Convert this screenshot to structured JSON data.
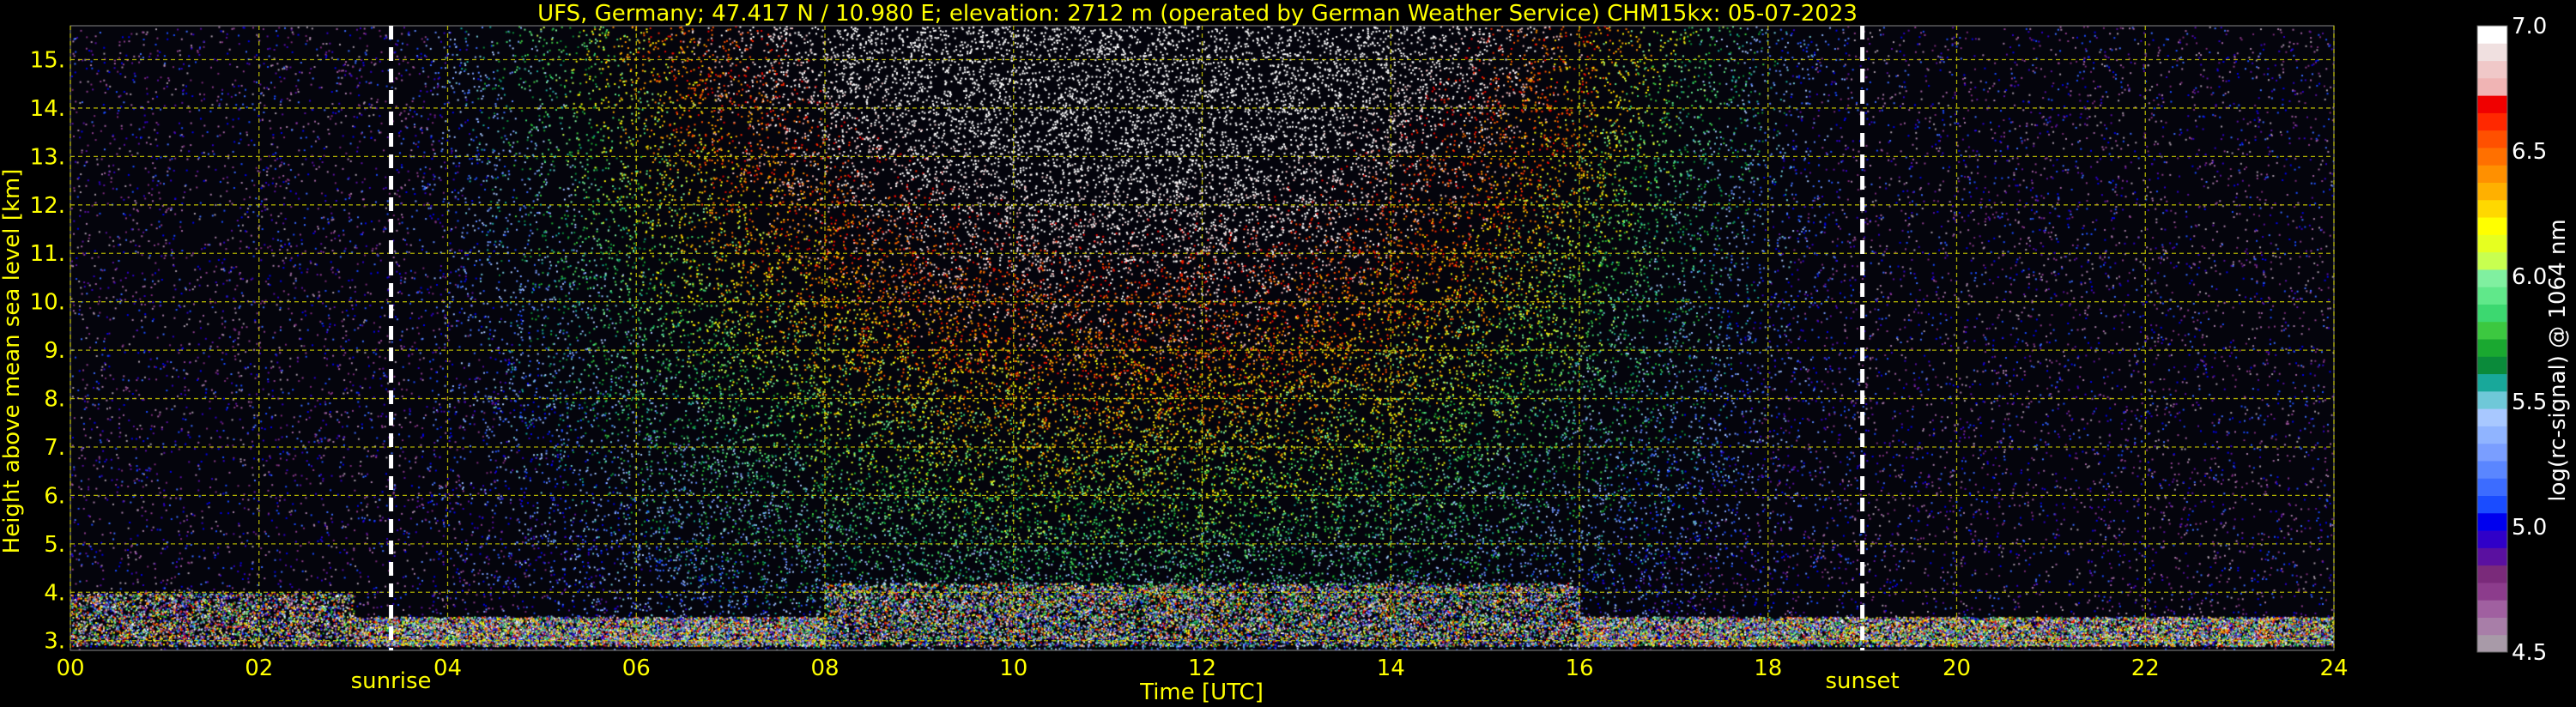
{
  "chart_data": {
    "type": "heatmap",
    "title": "UFS, Germany; 47.417 N / 10.980 E; elevation: 2712 m  (operated by German Weather Service)    CHM15kx: 05-07-2023",
    "xlabel": "Time [UTC]",
    "ylabel": "Height above mean sea level [km]",
    "xlim": [
      0,
      24
    ],
    "ylim": [
      2.8,
      15.7
    ],
    "x_ticks": [
      {
        "v": 0,
        "label": "00"
      },
      {
        "v": 2,
        "label": "02"
      },
      {
        "v": 4,
        "label": "04"
      },
      {
        "v": 6,
        "label": "06"
      },
      {
        "v": 8,
        "label": "08"
      },
      {
        "v": 10,
        "label": "10"
      },
      {
        "v": 12,
        "label": "12"
      },
      {
        "v": 14,
        "label": "14"
      },
      {
        "v": 16,
        "label": "16"
      },
      {
        "v": 18,
        "label": "18"
      },
      {
        "v": 20,
        "label": "20"
      },
      {
        "v": 22,
        "label": "22"
      },
      {
        "v": 24,
        "label": "24"
      }
    ],
    "y_ticks": [
      {
        "v": 3,
        "label": "3."
      },
      {
        "v": 4,
        "label": "4."
      },
      {
        "v": 5,
        "label": "5."
      },
      {
        "v": 6,
        "label": "6."
      },
      {
        "v": 7,
        "label": "7."
      },
      {
        "v": 8,
        "label": "8."
      },
      {
        "v": 9,
        "label": "9."
      },
      {
        "v": 10,
        "label": "10."
      },
      {
        "v": 11,
        "label": "11."
      },
      {
        "v": 12,
        "label": "12."
      },
      {
        "v": 13,
        "label": "13."
      },
      {
        "v": 14,
        "label": "14."
      },
      {
        "v": 15,
        "label": "15."
      }
    ],
    "grid": true,
    "annotations": [
      {
        "time": 3.4,
        "label": "sunrise"
      },
      {
        "time": 19.0,
        "label": "sunset"
      }
    ],
    "colorbar": {
      "label": "log(rc-signal) @ 1064 nm",
      "range": [
        4.5,
        7.0
      ],
      "ticks": [
        {
          "v": 4.5,
          "label": "4.5"
        },
        {
          "v": 5.0,
          "label": "5.0"
        },
        {
          "v": 5.5,
          "label": "5.5"
        },
        {
          "v": 6.0,
          "label": "6.0"
        },
        {
          "v": 6.5,
          "label": "6.5"
        },
        {
          "v": 7.0,
          "label": "7.0"
        }
      ],
      "colors": [
        "#a89aa8",
        "#a87ea8",
        "#a060a0",
        "#8c3c8c",
        "#7a2a7a",
        "#5a10a0",
        "#3000c8",
        "#0000ee",
        "#1a4cff",
        "#3c6cff",
        "#5a86ff",
        "#7a9eff",
        "#90b4ff",
        "#a8c8ff",
        "#6fc8d8",
        "#18a89a",
        "#0a8a3a",
        "#1aa830",
        "#3cc840",
        "#3cd870",
        "#60e88a",
        "#80f0a0",
        "#c8ff50",
        "#e6ff20",
        "#ffff00",
        "#ffd800",
        "#ffb000",
        "#ff9000",
        "#ff7000",
        "#ff5000",
        "#ff2800",
        "#f00000",
        "#f0b4b4",
        "#f0c8c8",
        "#f0e0e0",
        "#ffffff"
      ]
    },
    "colors": {
      "text": "#ffff00",
      "grid": "#cccc00",
      "background": "#000000",
      "marker": "#ffffff"
    }
  }
}
